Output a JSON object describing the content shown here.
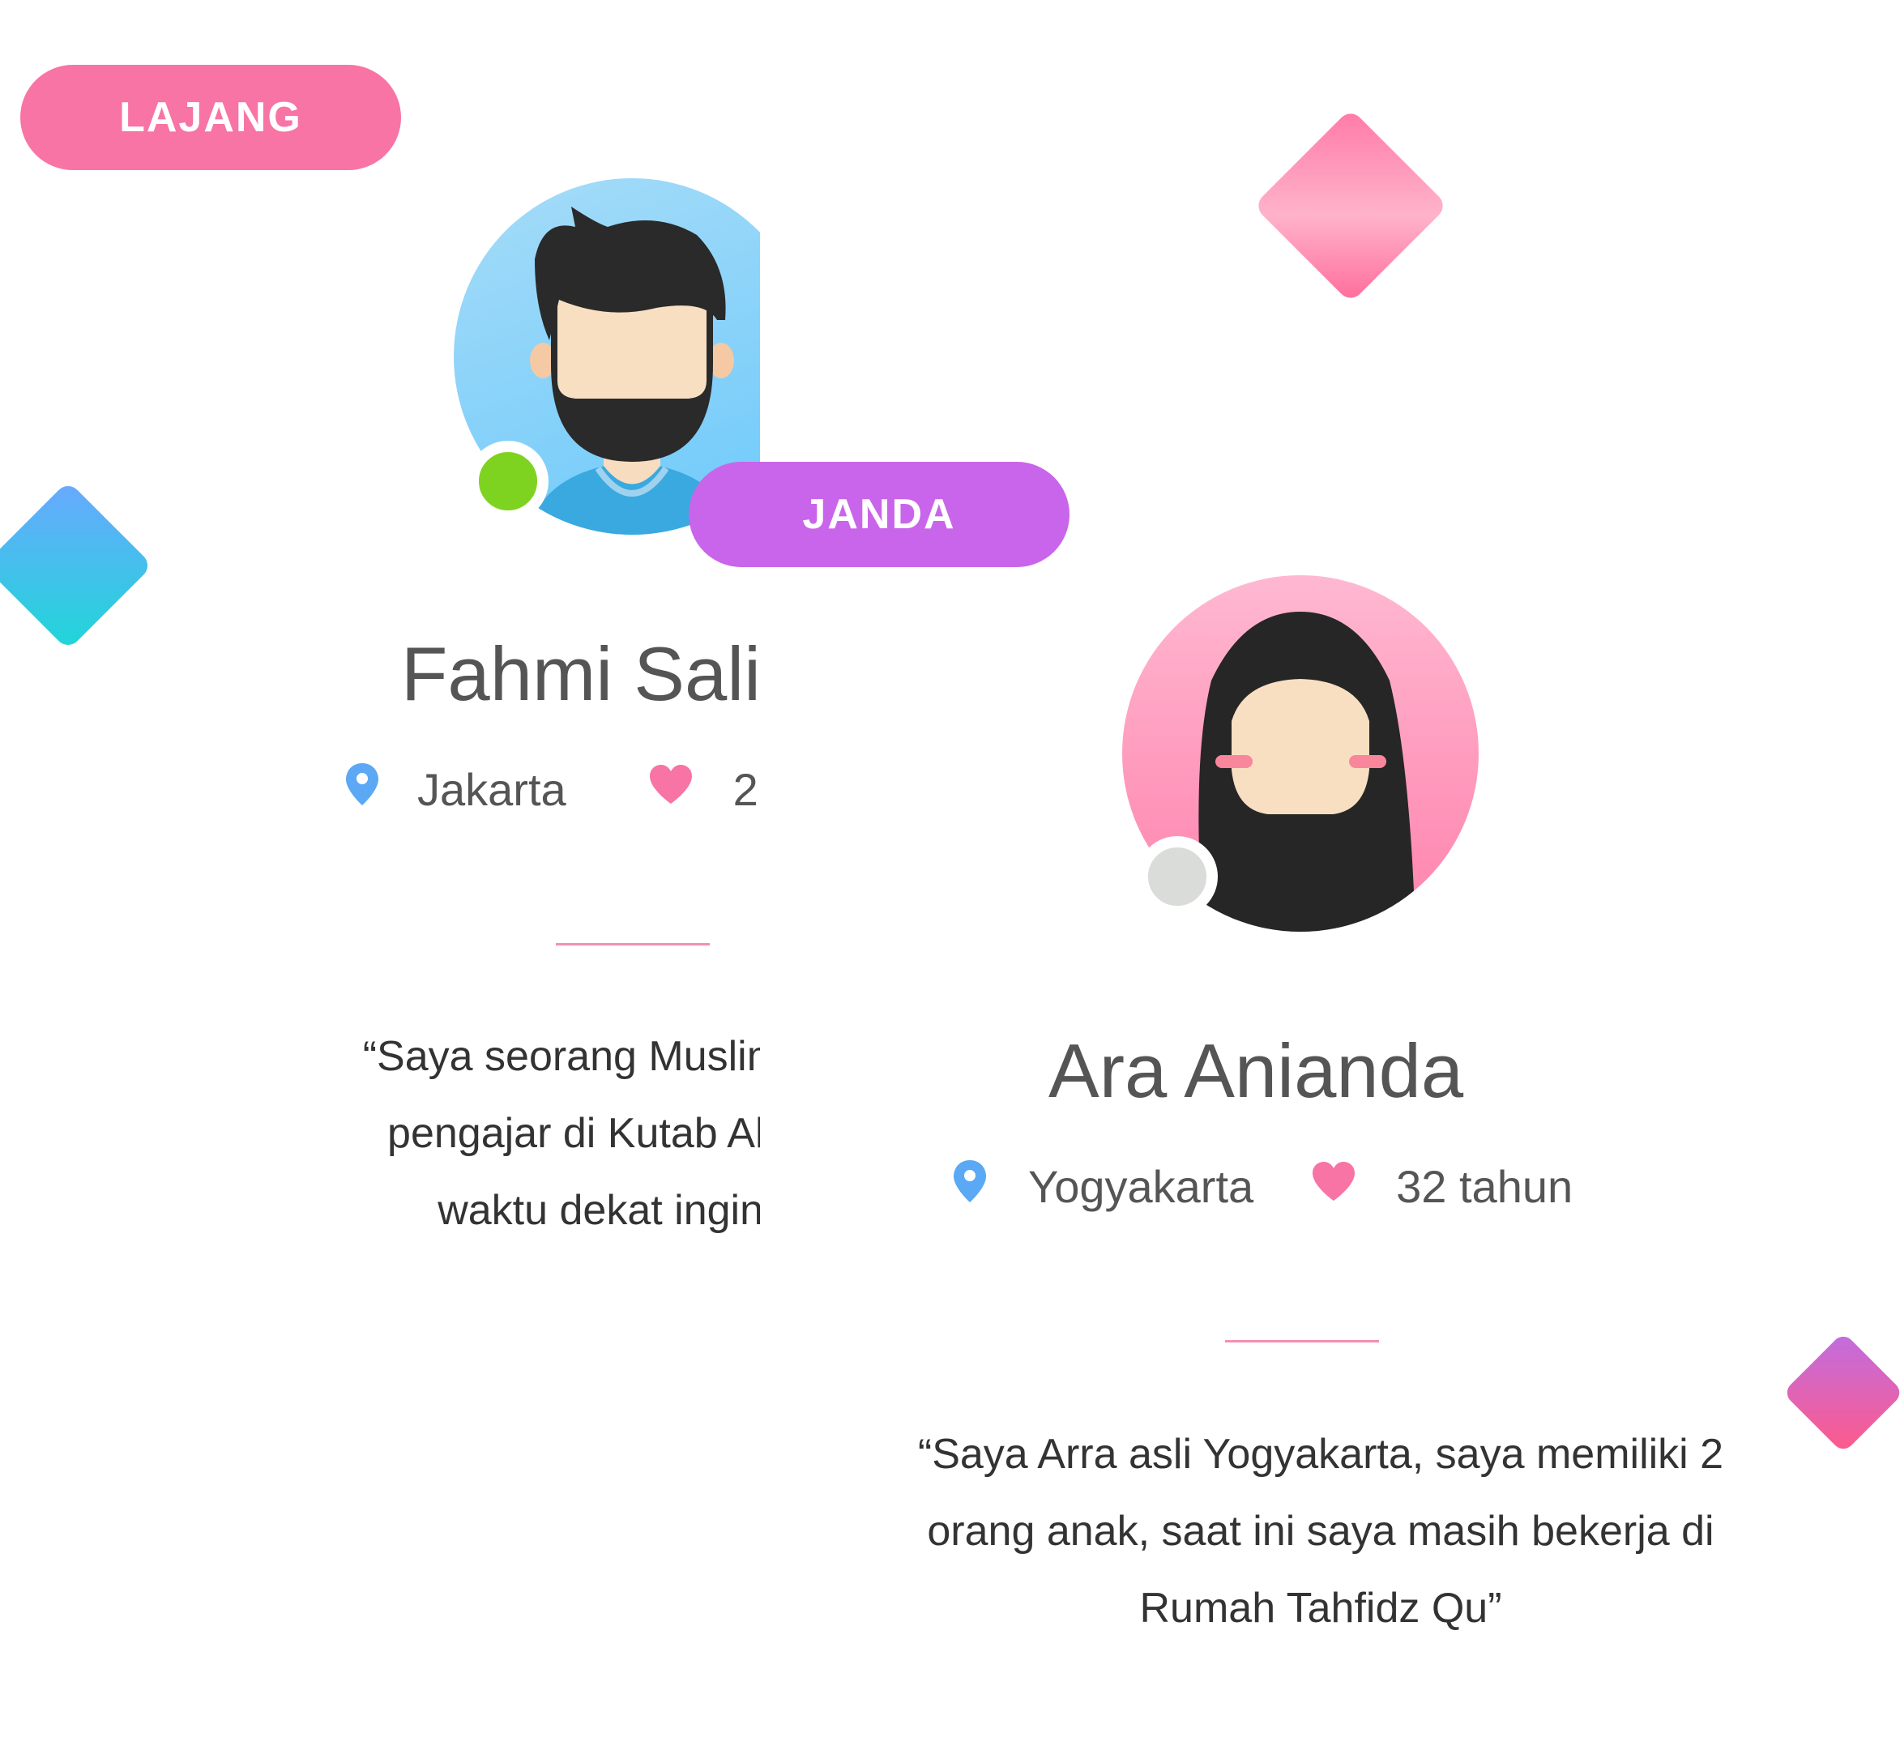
{
  "colors": {
    "pink_accent": "#f774a4",
    "purple_accent": "#c965ea",
    "online": "#7ed321",
    "offline": "#d9dcd8",
    "location_icon": "#5ba8f5",
    "heart_icon": "#f774a4"
  },
  "profiles": [
    {
      "status_badge": "LAJANG",
      "name": "Fahmi Sali",
      "location": "Jakarta",
      "age": "2",
      "online": true,
      "avatar_icon": "male-beard-avatar-icon",
      "bio": "“Saya seorang Muslim yang\npengajar di Kutab Al-Fatti\nwaktu dekat ingin m"
    },
    {
      "status_badge": "JANDA",
      "name": "Ara Anianda",
      "location": "Yogyakarta",
      "age": "32 tahun",
      "online": false,
      "avatar_icon": "female-hijab-avatar-icon",
      "bio": "“Saya Arra asli Yogyakarta, saya memiliki 2\norang anak, saat ini saya masih bekerja di\nRumah Tahfidz Qu”"
    }
  ]
}
